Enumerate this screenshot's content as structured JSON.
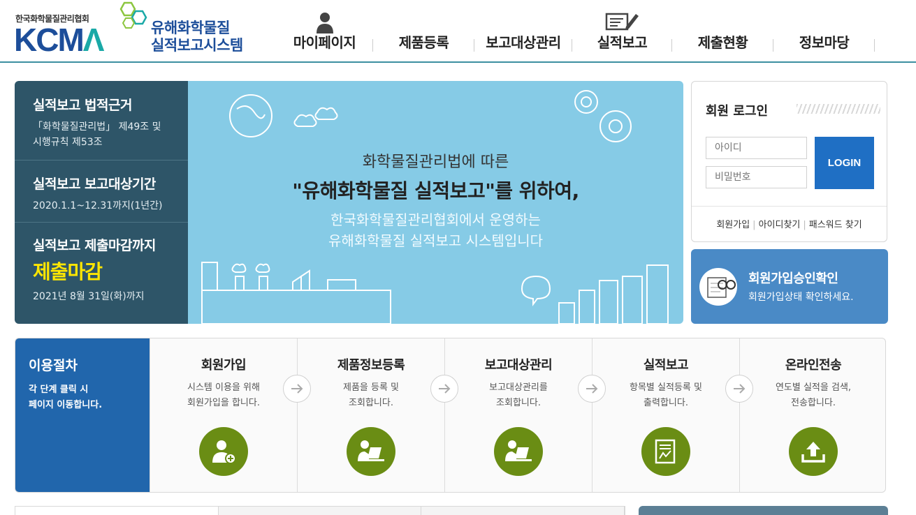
{
  "header": {
    "org_name": "한국화학물질관리협회",
    "logo_text_1": "KCM",
    "logo_text_2": "Λ",
    "title_line1": "유해화학물질",
    "title_line2": "실적보고시스템",
    "nav": [
      {
        "label": "마이페이지"
      },
      {
        "label": "제품등록"
      },
      {
        "label": "보고대상관리"
      },
      {
        "label": "실적보고"
      },
      {
        "label": "제출현황"
      },
      {
        "label": "정보마당"
      }
    ]
  },
  "info": {
    "legal": {
      "title": "실적보고 법적근거",
      "desc1": "「화학물질관리법」 제49조 및",
      "desc2": "시행규칙 제53조"
    },
    "period": {
      "title": "실적보고 보고대상기간",
      "desc": "2020.1.1~12.31까지(1년간)"
    },
    "deadline": {
      "title": "실적보고 제출마감까지",
      "highlight": "제출마감",
      "desc": "2021년 8월 31일(화)까지"
    }
  },
  "banner": {
    "line1": "화학물질관리법에 따른",
    "line2": "\"유해화학물질 실적보고\"를 위하여,",
    "line3": "한국화학물질관리협회에서 운영하는",
    "line4": "유해화학물질 실적보고 시스템입니다"
  },
  "login": {
    "title": "회원 로그인",
    "id_placeholder": "아이디",
    "pw_placeholder": "비밀번호",
    "button": "LOGIN",
    "links": {
      "join": "회원가입",
      "find_id": "아이디찾기",
      "find_pw": "패스워드 찾기"
    }
  },
  "approve": {
    "title": "회원가입승인확인",
    "desc": "회원가입상태 확인하세요."
  },
  "process": {
    "title": "이용절차",
    "desc1": "각 단계 클릭 시",
    "desc2": "페이지 이동합니다.",
    "steps": [
      {
        "title": "회원가입",
        "d1": "시스템 이용을 위해",
        "d2": "회원가입을 합니다.",
        "icon": "user-add-icon"
      },
      {
        "title": "제품정보등록",
        "d1": "제품을 등록 및",
        "d2": "조회합니다.",
        "icon": "user-laptop-icon"
      },
      {
        "title": "보고대상관리",
        "d1": "보고대상관리를",
        "d2": "조회합니다.",
        "icon": "user-laptop-icon"
      },
      {
        "title": "실적보고",
        "d1": "항목별 실적등록 및",
        "d2": "출력합니다.",
        "icon": "report-chart-icon"
      },
      {
        "title": "온라인전송",
        "d1": "연도별 실적을 검색,",
        "d2": "전송합니다.",
        "icon": "upload-icon"
      }
    ]
  },
  "colors": {
    "brand": "#1d4e9a",
    "info_bg": "#2e5568",
    "banner_bg": "#86cbe6",
    "login_btn": "#1f6fc4",
    "approve_bg": "#4a8ac6",
    "process_head": "#2166ac",
    "step_icon": "#6a8d14",
    "deadline": "#ffe600"
  }
}
